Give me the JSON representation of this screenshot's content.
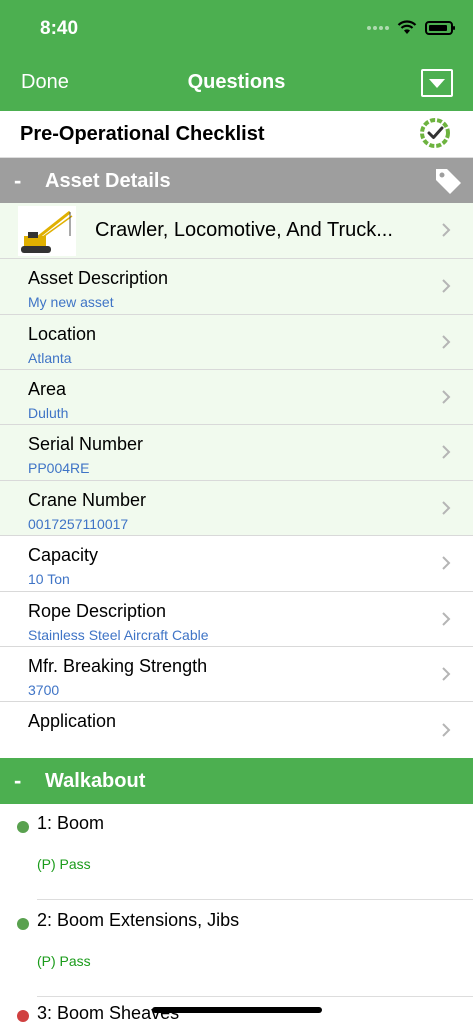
{
  "status_bar": {
    "time": "8:40"
  },
  "nav": {
    "done_label": "Done",
    "title": "Questions"
  },
  "checklist": {
    "title": "Pre-Operational Checklist"
  },
  "asset_section": {
    "collapse_symbol": "-",
    "label": "Asset Details",
    "asset_name": "Crawler, Locomotive, And Truck...",
    "rows": [
      {
        "title": "Asset Description",
        "value": "My new asset"
      },
      {
        "title": "Location",
        "value": "Atlanta"
      },
      {
        "title": "Area",
        "value": "Duluth"
      },
      {
        "title": "Serial Number",
        "value": "PP004RE"
      },
      {
        "title": "Crane Number",
        "value": "0017257110017"
      },
      {
        "title": "Capacity",
        "value": "10 Ton"
      },
      {
        "title": "Rope Description",
        "value": "Stainless Steel Aircraft Cable"
      },
      {
        "title": "Mfr. Breaking Strength",
        "value": "3700"
      },
      {
        "title": "Application",
        "value": ""
      }
    ]
  },
  "walkabout_section": {
    "collapse_symbol": "-",
    "label": "Walkabout",
    "items": [
      {
        "title": "1: Boom",
        "result": "(P) Pass",
        "status": "green"
      },
      {
        "title": "2: Boom Extensions, Jibs",
        "result": "(P) Pass",
        "status": "green"
      },
      {
        "title": "3: Boom Sheaves",
        "result": "",
        "status": "red"
      }
    ]
  },
  "colors": {
    "header_green": "#4caf50",
    "section_gray": "#9e9e9e",
    "value_blue": "#3f74c6",
    "pass_green": "#1a9b1a",
    "row_tint": "#f1faee"
  },
  "icons": {
    "dropdown": "triangle-down-box-icon",
    "checklist_status": "checkmark-circle-icon",
    "asset_tag": "tag-icon",
    "row_disclosure": "chevron-right-icon",
    "asset_thumbnail": "crawler-crane-icon"
  }
}
